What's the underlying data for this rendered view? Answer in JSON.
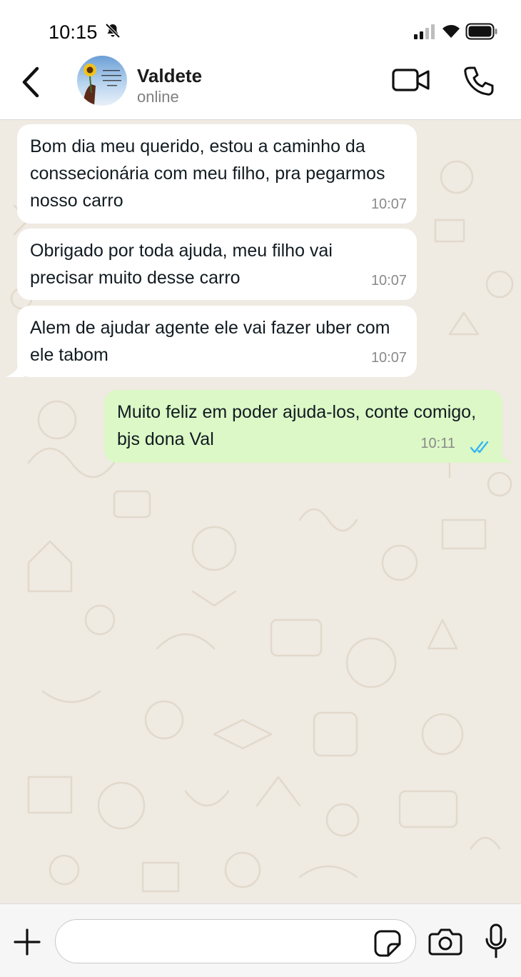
{
  "status_bar": {
    "time": "10:15",
    "icons": [
      "bell-off-icon",
      "signal-icon",
      "wifi-icon",
      "battery-icon"
    ]
  },
  "header": {
    "back_icon": "chevron-left-icon",
    "contact_name": "Valdete",
    "contact_status": "online",
    "video_icon": "video-camera-icon",
    "call_icon": "phone-icon"
  },
  "messages": [
    {
      "direction": "incoming",
      "text": "Bom dia meu querido, estou a caminho da conssecionária com meu filho, pra pegarmos nosso carro",
      "time": "10:07"
    },
    {
      "direction": "incoming",
      "text": "Obrigado por toda ajuda, meu filho vai precisar muito desse carro",
      "time": "10:07"
    },
    {
      "direction": "incoming",
      "text": "Alem de ajudar agente ele vai fazer uber com ele tabom",
      "time": "10:07"
    },
    {
      "direction": "outgoing",
      "text": "Muito feliz em poder ajuda-los, conte comigo, bjs dona Val",
      "time": "10:11",
      "status": "read"
    }
  ],
  "input_bar": {
    "placeholder": "",
    "icons": [
      "plus-icon",
      "sticker-icon",
      "camera-icon",
      "microphone-icon"
    ]
  },
  "colors": {
    "chat_background": "#efeae2",
    "incoming_bubble": "#ffffff",
    "outgoing_bubble": "#dcf8c6",
    "read_ticks": "#34b7f1",
    "time_text": "#8a8a8a"
  }
}
